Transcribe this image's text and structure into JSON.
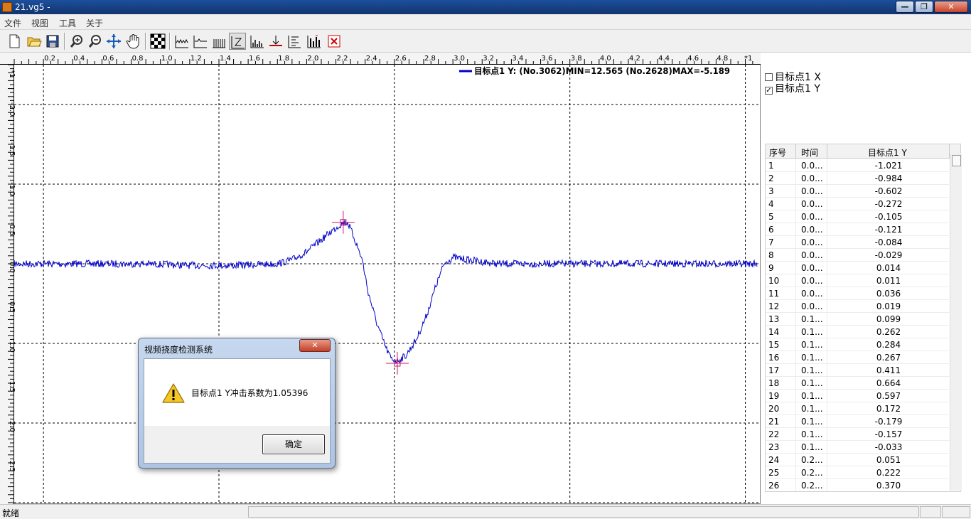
{
  "window": {
    "title": "21.vg5 -",
    "min_glyph": "—",
    "max_glyph": "❐",
    "close_glyph": "✕"
  },
  "menu": {
    "items": [
      "文件",
      "视图",
      "工具",
      "关于"
    ]
  },
  "toolbar": {
    "buttons": [
      "new-file-icon",
      "open-file-icon",
      "save-icon",
      "zoom-in-icon",
      "zoom-out-icon",
      "fit-view-icon",
      "pan-hand-icon",
      "checker-icon",
      "wave-chart-icon",
      "line-chart-icon",
      "bars-chart-icon",
      "cursor-mode-icon",
      "histogram-icon",
      "baseline-icon",
      "align-icon",
      "bar-mark-icon",
      "delete-icon"
    ]
  },
  "chart_data": {
    "type": "line",
    "x_ticks": [
      "0.2",
      "0.4",
      "0.6",
      "0.8",
      "1.0",
      "1.2",
      "1.4",
      "1.6",
      "1.8",
      "2.0",
      "2.2",
      "2.4",
      "2.6",
      "2.8",
      "3.0",
      "3.2",
      "3.4",
      "3.6",
      "3.8",
      "4.0",
      "4.2",
      "4.4",
      "4.6",
      "4.8"
    ],
    "x_axis_suffix": "*1",
    "y_ticks": [
      "-2.0",
      "-1.5",
      "-1.0",
      "-0.5",
      "0.0",
      "0.5",
      "1.0",
      "1.5",
      "2.0",
      "2.5"
    ],
    "y_axis_suffix": "*1",
    "xlim": [
      0,
      5.08
    ],
    "ylim": [
      -2.5,
      3.0
    ],
    "y_inverted": true,
    "grid": true,
    "series": [
      {
        "name": "目标点1 Y",
        "color": "#0000c8",
        "points": [
          [
            0,
            0.0
          ],
          [
            0.3,
            0.0
          ],
          [
            0.6,
            0.0
          ],
          [
            0.9,
            0.0
          ],
          [
            1.2,
            0.02
          ],
          [
            1.5,
            0.02
          ],
          [
            1.8,
            0.0
          ],
          [
            1.9,
            -0.05
          ],
          [
            2.0,
            -0.15
          ],
          [
            2.1,
            -0.3
          ],
          [
            2.15,
            -0.38
          ],
          [
            2.2,
            -0.45
          ],
          [
            2.25,
            -0.52
          ],
          [
            2.28,
            -0.52
          ],
          [
            2.32,
            -0.35
          ],
          [
            2.38,
            -0.05
          ],
          [
            2.42,
            0.35
          ],
          [
            2.48,
            0.75
          ],
          [
            2.54,
            1.05
          ],
          [
            2.58,
            1.2
          ],
          [
            2.62,
            1.22
          ],
          [
            2.68,
            1.15
          ],
          [
            2.75,
            0.95
          ],
          [
            2.82,
            0.65
          ],
          [
            2.88,
            0.3
          ],
          [
            2.94,
            0.0
          ],
          [
            3.0,
            -0.08
          ],
          [
            3.1,
            -0.05
          ],
          [
            3.3,
            0.0
          ],
          [
            3.7,
            0.0
          ],
          [
            4.2,
            0.0
          ],
          [
            4.6,
            0.0
          ],
          [
            5.08,
            0.0
          ]
        ]
      }
    ],
    "markers": [
      {
        "x": 2.25,
        "y": -0.52,
        "color": "#c8186e"
      },
      {
        "x": 2.62,
        "y": 1.25,
        "color": "#c8186e"
      }
    ]
  },
  "legend": {
    "text": "目标点1 Y: (No.3062)MIN=12.565  (No.2628)MAX=-5.189"
  },
  "series_toggles": [
    {
      "label": "目标点1 X",
      "checked": false
    },
    {
      "label": "目标点1 Y",
      "checked": true
    }
  ],
  "table": {
    "headers": [
      "序号",
      "时间",
      "目标点1 Y"
    ],
    "rows": [
      [
        "1",
        "0.0...",
        "-1.021"
      ],
      [
        "2",
        "0.0...",
        "-0.984"
      ],
      [
        "3",
        "0.0...",
        "-0.602"
      ],
      [
        "4",
        "0.0...",
        "-0.272"
      ],
      [
        "5",
        "0.0...",
        "-0.105"
      ],
      [
        "6",
        "0.0...",
        "-0.121"
      ],
      [
        "7",
        "0.0...",
        "-0.084"
      ],
      [
        "8",
        "0.0...",
        "-0.029"
      ],
      [
        "9",
        "0.0...",
        "0.014"
      ],
      [
        "10",
        "0.0...",
        "0.011"
      ],
      [
        "11",
        "0.0...",
        "0.036"
      ],
      [
        "12",
        "0.0...",
        "0.019"
      ],
      [
        "13",
        "0.1...",
        "0.099"
      ],
      [
        "14",
        "0.1...",
        "0.262"
      ],
      [
        "15",
        "0.1...",
        "0.284"
      ],
      [
        "16",
        "0.1...",
        "0.267"
      ],
      [
        "17",
        "0.1...",
        "0.411"
      ],
      [
        "18",
        "0.1...",
        "0.664"
      ],
      [
        "19",
        "0.1...",
        "0.597"
      ],
      [
        "20",
        "0.1...",
        "0.172"
      ],
      [
        "21",
        "0.1...",
        "-0.179"
      ],
      [
        "22",
        "0.1...",
        "-0.157"
      ],
      [
        "23",
        "0.1...",
        "-0.033"
      ],
      [
        "24",
        "0.2...",
        "0.051"
      ],
      [
        "25",
        "0.2...",
        "0.222"
      ],
      [
        "26",
        "0.2...",
        "0.370"
      ]
    ]
  },
  "status": {
    "text": "就绪"
  },
  "dialog": {
    "title": "视频挠度检测系统",
    "close_glyph": "✕",
    "message": "目标点1 Y冲击系数为1.05396",
    "ok_label": "确定"
  }
}
